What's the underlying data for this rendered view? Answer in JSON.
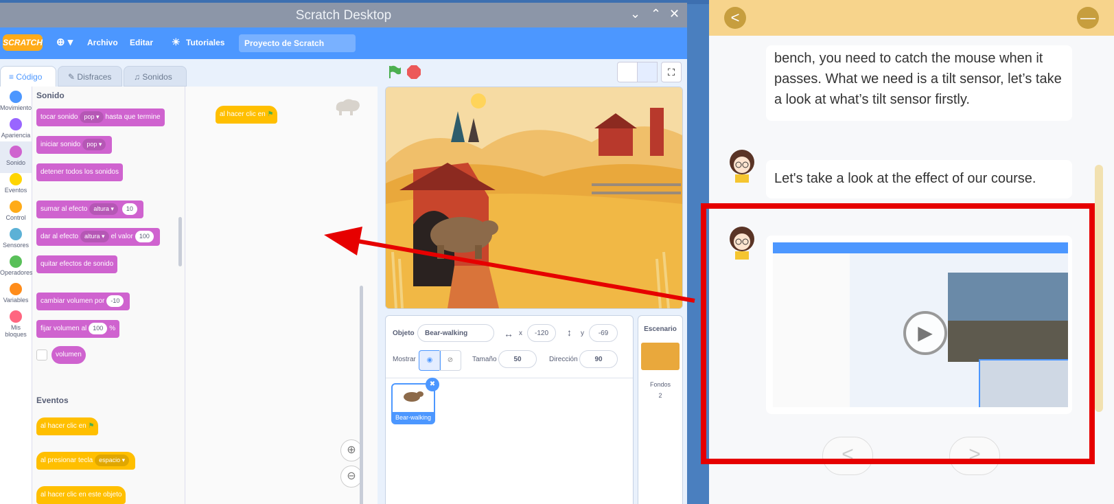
{
  "window": {
    "title": "Scratch Desktop"
  },
  "menubar": {
    "logo": "SCRATCH",
    "globe": "⊕ ▾",
    "archivo": "Archivo",
    "editar": "Editar",
    "tutoriales": "Tutoriales",
    "project": "Proyecto de Scratch"
  },
  "tabs": {
    "codigo": "Código",
    "disfraces": "Disfraces",
    "sonidos": "Sonidos"
  },
  "categories": [
    {
      "label": "Movimiento",
      "color": "#4c97ff"
    },
    {
      "label": "Apariencia",
      "color": "#9966ff"
    },
    {
      "label": "Sonido",
      "color": "#cf63cf"
    },
    {
      "label": "Eventos",
      "color": "#ffd500"
    },
    {
      "label": "Control",
      "color": "#ffab19"
    },
    {
      "label": "Sensores",
      "color": "#5cb1d6"
    },
    {
      "label": "Operadores",
      "color": "#59c059"
    },
    {
      "label": "Variables",
      "color": "#ff8c1a"
    },
    {
      "label": "Mis bloques",
      "color": "#ff6680"
    }
  ],
  "palette": {
    "sonido_title": "Sonido",
    "b1": {
      "a": "tocar sonido",
      "p": "pop ▾",
      "b": "hasta que termine"
    },
    "b2": {
      "a": "iniciar sonido",
      "p": "pop ▾"
    },
    "b3": "detener todos los sonidos",
    "b4": {
      "a": "sumar al efecto",
      "p": "altura ▾",
      "v": "10"
    },
    "b5": {
      "a": "dar al efecto",
      "p": "altura ▾",
      "b": "el valor",
      "v": "100"
    },
    "b6": "quitar efectos de sonido",
    "b7": {
      "a": "cambiar volumen por",
      "v": "-10"
    },
    "b8": {
      "a": "fijar volumen al",
      "v": "100",
      "u": "%"
    },
    "b9": "volumen",
    "eventos_title": "Eventos",
    "e1": "al hacer clic en",
    "e2": {
      "a": "al presionar tecla",
      "p": "espacio ▾"
    },
    "e3": "al hacer clic en este objeto"
  },
  "workspace": {
    "block": "al hacer clic en"
  },
  "sprite": {
    "objeto_label": "Objeto",
    "objeto_value": "Bear-walking",
    "x_label": "x",
    "x_value": "-120",
    "y_label": "y",
    "y_value": "-69",
    "mostrar_label": "Mostrar",
    "tamano_label": "Tamaño",
    "tamano_value": "50",
    "direccion_label": "Dirección",
    "direccion_value": "90",
    "thumb_label": "Bear-walking"
  },
  "backdrop": {
    "title": "Escenario",
    "fondos_label": "Fondos",
    "fondos_count": "2"
  },
  "course": {
    "msg1": "bench, you need to catch the mouse when it passes. What we need is a tilt sensor, let’s take a look at what’s tilt sensor firstly.",
    "msg2": "Let's take a look at the effect of our course.",
    "back_icon": "<",
    "min_icon": "—",
    "prev": "<",
    "next": ">"
  },
  "colors": {
    "scratch_blue": "#4c97ff",
    "sound": "#cf63cf",
    "events": "#ffbf00",
    "highlight": "#e60000"
  }
}
